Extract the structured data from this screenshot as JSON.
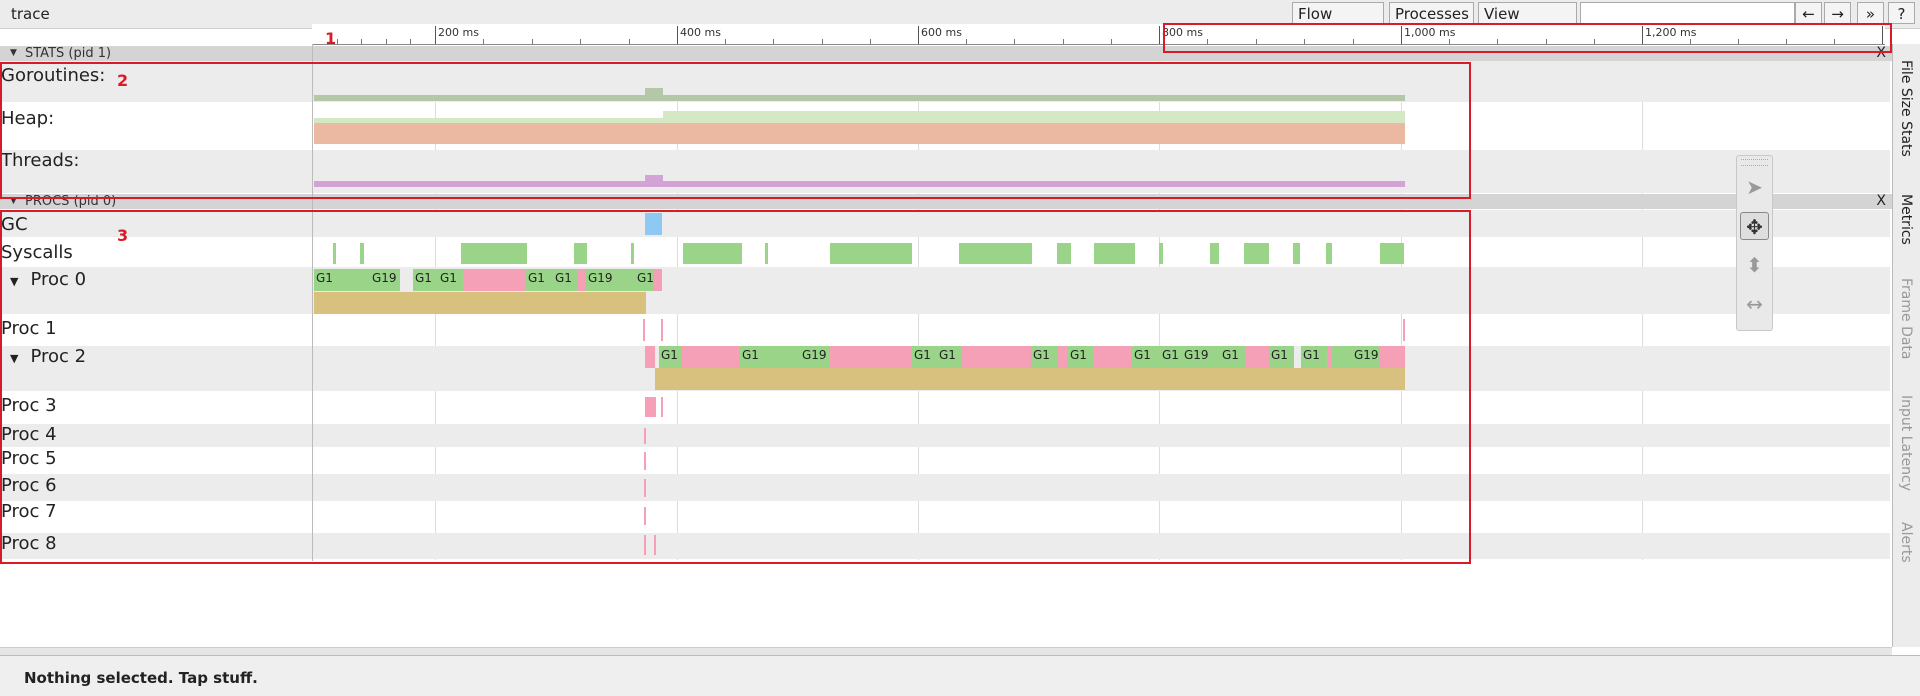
{
  "window": {
    "title": "trace"
  },
  "toolbar": {
    "flow_events": "Flow events",
    "processes": "Processes",
    "view_options": "View Options",
    "prev": "←",
    "next": "→",
    "more": "»",
    "help": "?"
  },
  "ruler": {
    "ticks": [
      "200 ms",
      "400 ms",
      "600 ms",
      "800 ms",
      "1,000 ms",
      "1,200 ms"
    ]
  },
  "sections": {
    "stats": {
      "label": "STATS (pid 1)",
      "close": "X"
    },
    "procs": {
      "label": "PROCS (pid 0)",
      "close": "X"
    }
  },
  "stats_rows": [
    "Goroutines:",
    "Heap:",
    "Threads:"
  ],
  "procs_rows": {
    "gc": "GC",
    "syscalls": "Syscalls",
    "proc0": "Proc 0",
    "proc1": "Proc 1",
    "proc2": "Proc 2",
    "proc3": "Proc 3",
    "proc4": "Proc 4",
    "proc5": "Proc 5",
    "proc6": "Proc 6",
    "proc7": "Proc 7",
    "proc8": "Proc 8"
  },
  "slices": {
    "g1": "G1",
    "g19": "G19"
  },
  "side_tabs": [
    "File Size Stats",
    "Metrics",
    "Frame Data",
    "Input Latency",
    "Alerts"
  ],
  "annotations": [
    "1",
    "2",
    "3"
  ],
  "status": "Nothing selected. Tap stuff.",
  "colors": {
    "running": "#99d489",
    "syscall": "#f5a0b7",
    "gc": "#8ec8f5",
    "annotation": "#d51c28"
  }
}
